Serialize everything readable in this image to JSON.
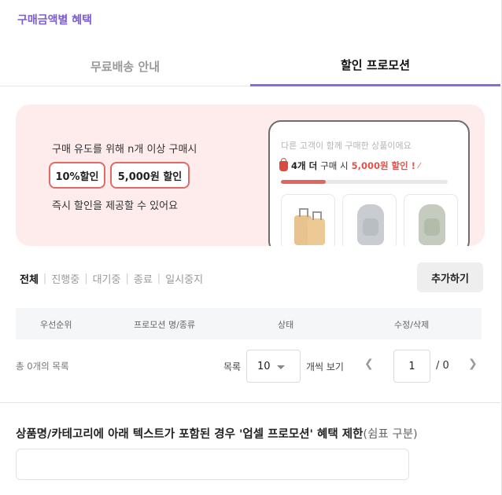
{
  "section_title": "구매금액별 혜택",
  "tabs": [
    {
      "label": "무료배송 안내",
      "active": false
    },
    {
      "label": "할인 프로모션",
      "active": true
    }
  ],
  "banner": {
    "line1": "구매 유도를 위해 n개 이상 구매시",
    "pill_1": "10%할인",
    "pill_2": "5,000원 할인",
    "line2": "즉시 할인을 제공할 수 있어요",
    "preview": {
      "caption": "다른 고객이 함께 구매한 상품이에요",
      "promo_count": "4개 더",
      "promo_mid": "구매 시",
      "promo_discount": "5,000원 할인 !",
      "progress": 0.27,
      "thumbnails": [
        "suitcase",
        "backpack-grey",
        "backpack-green"
      ]
    }
  },
  "filters": [
    "전체",
    "진행중",
    "대기중",
    "종료",
    "일시중지"
  ],
  "active_filter": "전체",
  "add_button": "추가하기",
  "table": {
    "headers": [
      "우선순위",
      "프로모션 명/종류",
      "상태",
      "수정/삭제"
    ],
    "rows": []
  },
  "pagination": {
    "total_text": "총 0개의 목록",
    "list_label": "목록",
    "per_page": "10",
    "per_page_suffix": "개씩 보기",
    "current_page": "1",
    "total_pages": "/ 0"
  },
  "exclude": {
    "title": "상품명/카테고리에 아래 텍스트가 포함된 경우 '업셀 프로모션' 혜택 제한",
    "hint": "(쉼표 구분)",
    "value": ""
  },
  "colors": {
    "accent": "#7b5cd6",
    "tab_underline": "#8a6ae0",
    "banner_bg": "#fdeceb",
    "pill_border": "#e06a66",
    "discount": "#e0524b"
  }
}
